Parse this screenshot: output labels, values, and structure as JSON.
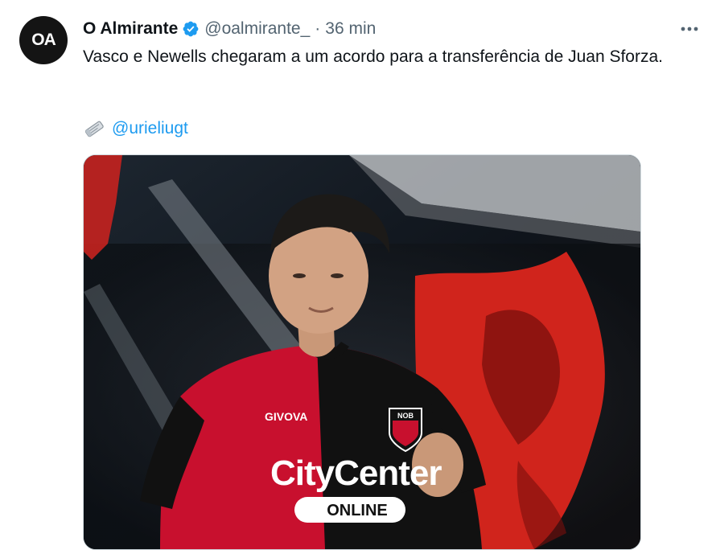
{
  "tweet": {
    "avatar_initials": "OA",
    "display_name": "O Almirante",
    "handle": "@oalmirante_",
    "separator": "·",
    "time": "36 min",
    "text": "Vasco e Newells chegaram a um acordo para a transferência de Juan Sforza.",
    "credit_icon": "newspaper-icon",
    "credit_mention": "@urieliugt"
  },
  "media": {
    "jersey_brand": "GIVOVA",
    "jersey_sponsor": "CityCenter",
    "jersey_sponsor_sub": "ONLINE",
    "badge_text": "NOB"
  },
  "colors": {
    "link": "#1d9bf0",
    "verified": "#1d9bf0",
    "secondary_text": "#536471",
    "jersey_red": "#c8102e",
    "jersey_black": "#111111"
  }
}
